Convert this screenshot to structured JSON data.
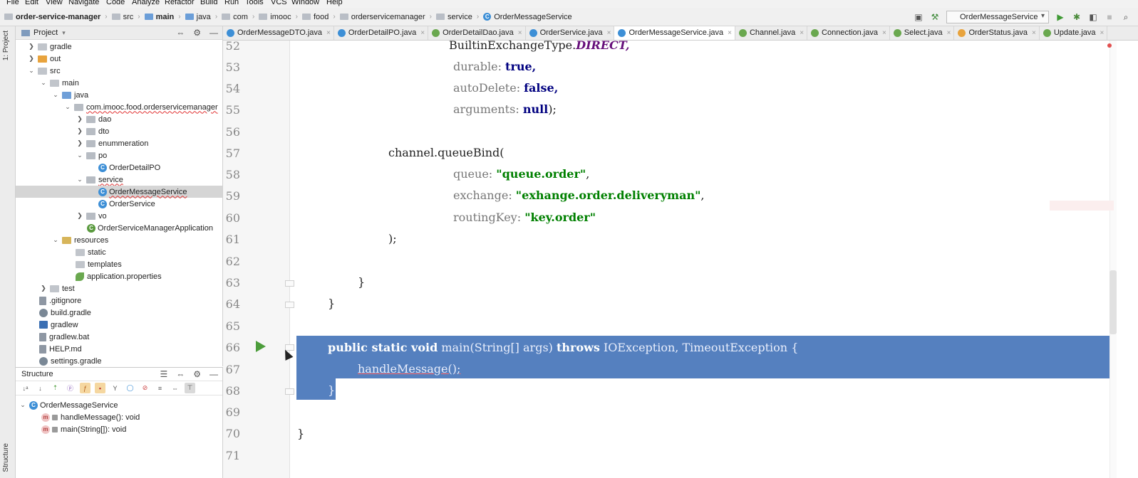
{
  "menu": [
    "File",
    "Edit",
    "View",
    "Navigate",
    "Code",
    "Analyze",
    "Refactor",
    "Build",
    "Run",
    "Tools",
    "VCS",
    "Window",
    "Help"
  ],
  "breadcrumb": [
    "order-service-manager",
    "src",
    "main",
    "java",
    "com",
    "imooc",
    "food",
    "orderservicemanager",
    "service",
    "OrderMessageService"
  ],
  "run_config": "OrderMessageService",
  "left_strip": {
    "project": "1: Project",
    "structure": "Structure"
  },
  "project_panel": {
    "title": "Project",
    "tree": [
      {
        "label": "gradle",
        "icon": "folder-icon",
        "expanded": false
      },
      {
        "label": "out",
        "icon": "folder-orange-icon",
        "expanded": false
      },
      {
        "label": "src",
        "icon": "folder-icon",
        "expanded": true
      },
      {
        "label": "main",
        "icon": "folder-icon",
        "expanded": true
      },
      {
        "label": "java",
        "icon": "folder-blue-icon",
        "expanded": true
      },
      {
        "label": "com.imooc.food.orderservicemanager",
        "icon": "package-icon",
        "expanded": true
      },
      {
        "label": "dao",
        "icon": "package-icon",
        "expanded": false
      },
      {
        "label": "dto",
        "icon": "package-icon",
        "expanded": false
      },
      {
        "label": "enummeration",
        "icon": "package-icon",
        "expanded": false
      },
      {
        "label": "po",
        "icon": "package-icon",
        "expanded": true
      },
      {
        "label": "OrderDetailPO",
        "icon": "class-icon"
      },
      {
        "label": "service",
        "icon": "package-icon",
        "expanded": true
      },
      {
        "label": "OrderMessageService",
        "icon": "class-icon",
        "selected": true
      },
      {
        "label": "OrderService",
        "icon": "class-icon"
      },
      {
        "label": "vo",
        "icon": "package-icon",
        "expanded": false
      },
      {
        "label": "OrderServiceManagerApplication",
        "icon": "spring-class-icon"
      },
      {
        "label": "resources",
        "icon": "resources-folder-icon",
        "expanded": true
      },
      {
        "label": "static",
        "icon": "folder-icon"
      },
      {
        "label": "templates",
        "icon": "folder-icon"
      },
      {
        "label": "application.properties",
        "icon": "properties-icon"
      },
      {
        "label": "test",
        "icon": "folder-icon",
        "expanded": false
      },
      {
        "label": ".gitignore",
        "icon": "file-icon"
      },
      {
        "label": "build.gradle",
        "icon": "gradle-icon"
      },
      {
        "label": "gradlew",
        "icon": "terminal-icon"
      },
      {
        "label": "gradlew.bat",
        "icon": "file-icon"
      },
      {
        "label": "HELP.md",
        "icon": "file-icon"
      },
      {
        "label": "settings.gradle",
        "icon": "gradle-icon"
      }
    ]
  },
  "structure_panel": {
    "title": "Structure",
    "class": "OrderMessageService",
    "members": [
      "handleMessage(): void",
      "main(String[]): void"
    ]
  },
  "tabs": [
    {
      "label": "OrderMessageDTO.java"
    },
    {
      "label": "OrderDetailPO.java"
    },
    {
      "label": "OrderDetailDao.java"
    },
    {
      "label": "OrderService.java"
    },
    {
      "label": "OrderMessageService.java",
      "active": true
    },
    {
      "label": "Channel.java"
    },
    {
      "label": "Connection.java"
    },
    {
      "label": "Select.java"
    },
    {
      "label": "OrderStatus.java"
    },
    {
      "label": "Update.java"
    }
  ],
  "editor": {
    "line_numbers": [
      "52",
      "53",
      "54",
      "55",
      "56",
      "57",
      "58",
      "59",
      "60",
      "61",
      "62",
      "63",
      "64",
      "65",
      "66",
      "67",
      "68",
      "69",
      "70",
      "71"
    ],
    "code": {
      "l52": "BuiltinExchangeType.",
      "l52_const": "DIRECT,",
      "l53_param": "durable:",
      "l53_val": "true,",
      "l54_param": "autoDelete:",
      "l54_val": "false,",
      "l55_param": "arguments:",
      "l55_val": "null",
      "l55_end": ");",
      "l57": "channel.queueBind(",
      "l58_param": "queue:",
      "l58_val": "\"queue.order\"",
      "l58_end": ",",
      "l59_param": "exchange:",
      "l59_val": "\"exhange.order.deliveryman\"",
      "l59_end": ",",
      "l60_param": "routingKey:",
      "l60_val": "\"key.order\"",
      "l61": ");",
      "l63": "}",
      "l64": "}",
      "l66_kw": "public static void",
      "l66_sig": "main(String[] args)",
      "l66_throws": "throws",
      "l66_ex": "IOException, TimeoutException {",
      "l67": "handleMessage();",
      "l68": "}",
      "l70": "}"
    }
  }
}
